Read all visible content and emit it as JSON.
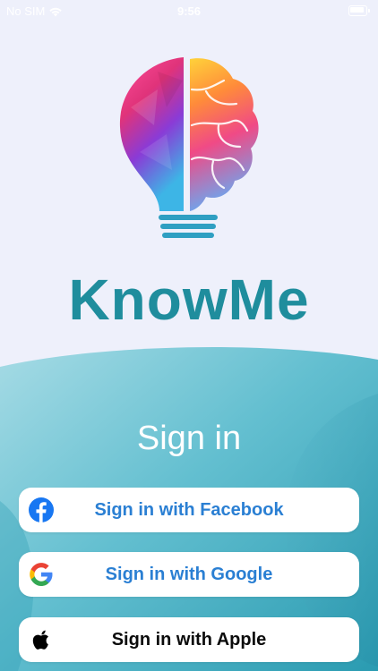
{
  "status_bar": {
    "carrier": "No SIM",
    "time": "9:56"
  },
  "brand": {
    "name": "KnowMe",
    "color": "#1f8d9d"
  },
  "signin": {
    "title": "Sign in",
    "buttons": [
      {
        "id": "facebook",
        "label": "Sign in with Facebook",
        "icon": "facebook-icon",
        "color": "#2a7fd3"
      },
      {
        "id": "google",
        "label": "Sign in with Google",
        "icon": "google-icon",
        "color": "#2a7fd3"
      },
      {
        "id": "apple",
        "label": "Sign in with Apple",
        "icon": "apple-icon",
        "color": "#0b0b0b"
      }
    ]
  },
  "colors": {
    "background": "#eef0fb",
    "wave": "#6cc4d3",
    "wave_dark": "#2f9fb5"
  }
}
